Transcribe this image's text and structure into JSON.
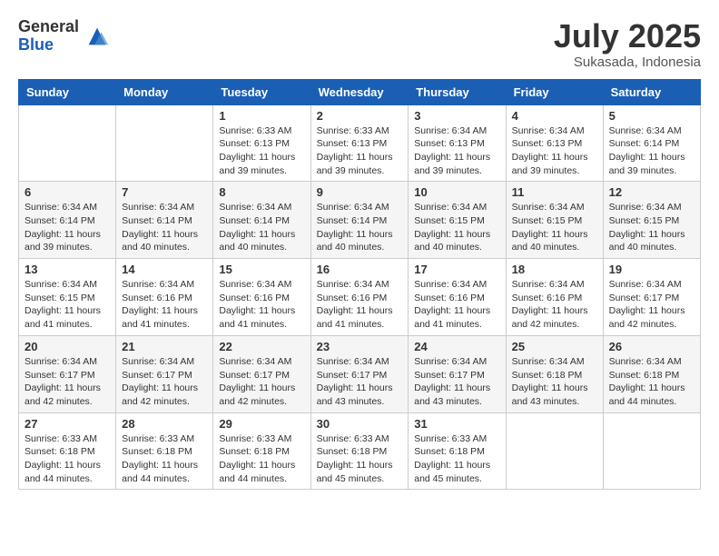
{
  "logo": {
    "general": "General",
    "blue": "Blue"
  },
  "title": "July 2025",
  "subtitle": "Sukasada, Indonesia",
  "days_of_week": [
    "Sunday",
    "Monday",
    "Tuesday",
    "Wednesday",
    "Thursday",
    "Friday",
    "Saturday"
  ],
  "weeks": [
    [
      {
        "day": "",
        "info": ""
      },
      {
        "day": "",
        "info": ""
      },
      {
        "day": "1",
        "info": "Sunrise: 6:33 AM\nSunset: 6:13 PM\nDaylight: 11 hours and 39 minutes."
      },
      {
        "day": "2",
        "info": "Sunrise: 6:33 AM\nSunset: 6:13 PM\nDaylight: 11 hours and 39 minutes."
      },
      {
        "day": "3",
        "info": "Sunrise: 6:34 AM\nSunset: 6:13 PM\nDaylight: 11 hours and 39 minutes."
      },
      {
        "day": "4",
        "info": "Sunrise: 6:34 AM\nSunset: 6:13 PM\nDaylight: 11 hours and 39 minutes."
      },
      {
        "day": "5",
        "info": "Sunrise: 6:34 AM\nSunset: 6:14 PM\nDaylight: 11 hours and 39 minutes."
      }
    ],
    [
      {
        "day": "6",
        "info": "Sunrise: 6:34 AM\nSunset: 6:14 PM\nDaylight: 11 hours and 39 minutes."
      },
      {
        "day": "7",
        "info": "Sunrise: 6:34 AM\nSunset: 6:14 PM\nDaylight: 11 hours and 40 minutes."
      },
      {
        "day": "8",
        "info": "Sunrise: 6:34 AM\nSunset: 6:14 PM\nDaylight: 11 hours and 40 minutes."
      },
      {
        "day": "9",
        "info": "Sunrise: 6:34 AM\nSunset: 6:14 PM\nDaylight: 11 hours and 40 minutes."
      },
      {
        "day": "10",
        "info": "Sunrise: 6:34 AM\nSunset: 6:15 PM\nDaylight: 11 hours and 40 minutes."
      },
      {
        "day": "11",
        "info": "Sunrise: 6:34 AM\nSunset: 6:15 PM\nDaylight: 11 hours and 40 minutes."
      },
      {
        "day": "12",
        "info": "Sunrise: 6:34 AM\nSunset: 6:15 PM\nDaylight: 11 hours and 40 minutes."
      }
    ],
    [
      {
        "day": "13",
        "info": "Sunrise: 6:34 AM\nSunset: 6:15 PM\nDaylight: 11 hours and 41 minutes."
      },
      {
        "day": "14",
        "info": "Sunrise: 6:34 AM\nSunset: 6:16 PM\nDaylight: 11 hours and 41 minutes."
      },
      {
        "day": "15",
        "info": "Sunrise: 6:34 AM\nSunset: 6:16 PM\nDaylight: 11 hours and 41 minutes."
      },
      {
        "day": "16",
        "info": "Sunrise: 6:34 AM\nSunset: 6:16 PM\nDaylight: 11 hours and 41 minutes."
      },
      {
        "day": "17",
        "info": "Sunrise: 6:34 AM\nSunset: 6:16 PM\nDaylight: 11 hours and 41 minutes."
      },
      {
        "day": "18",
        "info": "Sunrise: 6:34 AM\nSunset: 6:16 PM\nDaylight: 11 hours and 42 minutes."
      },
      {
        "day": "19",
        "info": "Sunrise: 6:34 AM\nSunset: 6:17 PM\nDaylight: 11 hours and 42 minutes."
      }
    ],
    [
      {
        "day": "20",
        "info": "Sunrise: 6:34 AM\nSunset: 6:17 PM\nDaylight: 11 hours and 42 minutes."
      },
      {
        "day": "21",
        "info": "Sunrise: 6:34 AM\nSunset: 6:17 PM\nDaylight: 11 hours and 42 minutes."
      },
      {
        "day": "22",
        "info": "Sunrise: 6:34 AM\nSunset: 6:17 PM\nDaylight: 11 hours and 42 minutes."
      },
      {
        "day": "23",
        "info": "Sunrise: 6:34 AM\nSunset: 6:17 PM\nDaylight: 11 hours and 43 minutes."
      },
      {
        "day": "24",
        "info": "Sunrise: 6:34 AM\nSunset: 6:17 PM\nDaylight: 11 hours and 43 minutes."
      },
      {
        "day": "25",
        "info": "Sunrise: 6:34 AM\nSunset: 6:18 PM\nDaylight: 11 hours and 43 minutes."
      },
      {
        "day": "26",
        "info": "Sunrise: 6:34 AM\nSunset: 6:18 PM\nDaylight: 11 hours and 44 minutes."
      }
    ],
    [
      {
        "day": "27",
        "info": "Sunrise: 6:33 AM\nSunset: 6:18 PM\nDaylight: 11 hours and 44 minutes."
      },
      {
        "day": "28",
        "info": "Sunrise: 6:33 AM\nSunset: 6:18 PM\nDaylight: 11 hours and 44 minutes."
      },
      {
        "day": "29",
        "info": "Sunrise: 6:33 AM\nSunset: 6:18 PM\nDaylight: 11 hours and 44 minutes."
      },
      {
        "day": "30",
        "info": "Sunrise: 6:33 AM\nSunset: 6:18 PM\nDaylight: 11 hours and 45 minutes."
      },
      {
        "day": "31",
        "info": "Sunrise: 6:33 AM\nSunset: 6:18 PM\nDaylight: 11 hours and 45 minutes."
      },
      {
        "day": "",
        "info": ""
      },
      {
        "day": "",
        "info": ""
      }
    ]
  ]
}
